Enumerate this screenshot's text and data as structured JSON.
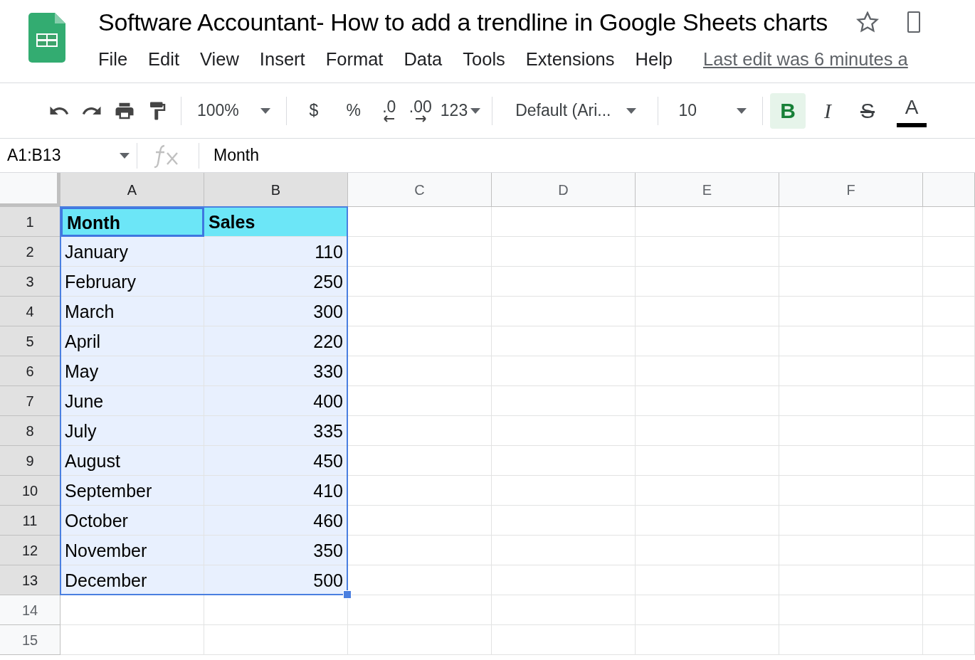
{
  "document": {
    "title": "Software Accountant- How to add a trendline in Google Sheets charts",
    "starred": false
  },
  "menu": [
    "File",
    "Edit",
    "View",
    "Insert",
    "Format",
    "Data",
    "Tools",
    "Extensions",
    "Help"
  ],
  "last_edit": "Last edit was 6 minutes a",
  "toolbar": {
    "zoom": "100%",
    "currency": "$",
    "percent": "%",
    "decrease_decimals": ".0",
    "increase_decimals": ".00",
    "number_format": "123",
    "font": "Default (Ari...",
    "font_size": "10",
    "styles": [
      {
        "kind": "bold",
        "label": "B",
        "on": true
      },
      {
        "kind": "italic",
        "label": "I",
        "on": false
      },
      {
        "kind": "strikethrough",
        "label": "S",
        "on": false
      }
    ],
    "text_color": {
      "label": "A",
      "color": "#000000"
    }
  },
  "formula_bar": {
    "name_box": "A1:B13",
    "formula": "Month"
  },
  "grid": {
    "columns": [
      {
        "label": "A",
        "selected": true
      },
      {
        "label": "B",
        "selected": true
      },
      {
        "label": "C",
        "selected": false
      },
      {
        "label": "D",
        "selected": false
      },
      {
        "label": "E",
        "selected": false
      },
      {
        "label": "F",
        "selected": false
      }
    ],
    "rows": [
      {
        "number": "1",
        "selected": true,
        "cells": [
          {
            "value": "Month",
            "kind": "header",
            "selected": true,
            "active": true
          },
          {
            "value": "Sales",
            "kind": "header",
            "selected": true,
            "active": false
          }
        ]
      },
      {
        "number": "2",
        "selected": true,
        "cells": [
          {
            "value": "January",
            "kind": "text",
            "selected": true,
            "active": false
          },
          {
            "value": "110",
            "kind": "number",
            "selected": true,
            "active": false
          }
        ]
      },
      {
        "number": "3",
        "selected": true,
        "cells": [
          {
            "value": "February",
            "kind": "text",
            "selected": true,
            "active": false
          },
          {
            "value": "250",
            "kind": "number",
            "selected": true,
            "active": false
          }
        ]
      },
      {
        "number": "4",
        "selected": true,
        "cells": [
          {
            "value": "March",
            "kind": "text",
            "selected": true,
            "active": false
          },
          {
            "value": "300",
            "kind": "number",
            "selected": true,
            "active": false
          }
        ]
      },
      {
        "number": "5",
        "selected": true,
        "cells": [
          {
            "value": "April",
            "kind": "text",
            "selected": true,
            "active": false
          },
          {
            "value": "220",
            "kind": "number",
            "selected": true,
            "active": false
          }
        ]
      },
      {
        "number": "6",
        "selected": true,
        "cells": [
          {
            "value": "May",
            "kind": "text",
            "selected": true,
            "active": false
          },
          {
            "value": "330",
            "kind": "number",
            "selected": true,
            "active": false
          }
        ]
      },
      {
        "number": "7",
        "selected": true,
        "cells": [
          {
            "value": "June",
            "kind": "text",
            "selected": true,
            "active": false
          },
          {
            "value": "400",
            "kind": "number",
            "selected": true,
            "active": false
          }
        ]
      },
      {
        "number": "8",
        "selected": true,
        "cells": [
          {
            "value": "July",
            "kind": "text",
            "selected": true,
            "active": false
          },
          {
            "value": "335",
            "kind": "number",
            "selected": true,
            "active": false
          }
        ]
      },
      {
        "number": "9",
        "selected": true,
        "cells": [
          {
            "value": "August",
            "kind": "text",
            "selected": true,
            "active": false
          },
          {
            "value": "450",
            "kind": "number",
            "selected": true,
            "active": false
          }
        ]
      },
      {
        "number": "10",
        "selected": true,
        "cells": [
          {
            "value": "September",
            "kind": "text",
            "selected": true,
            "active": false
          },
          {
            "value": "410",
            "kind": "number",
            "selected": true,
            "active": false
          }
        ]
      },
      {
        "number": "11",
        "selected": true,
        "cells": [
          {
            "value": "October",
            "kind": "text",
            "selected": true,
            "active": false
          },
          {
            "value": "460",
            "kind": "number",
            "selected": true,
            "active": false
          }
        ]
      },
      {
        "number": "12",
        "selected": true,
        "cells": [
          {
            "value": "November",
            "kind": "text",
            "selected": true,
            "active": false
          },
          {
            "value": "350",
            "kind": "number",
            "selected": true,
            "active": false
          }
        ]
      },
      {
        "number": "13",
        "selected": true,
        "cells": [
          {
            "value": "December",
            "kind": "text",
            "selected": true,
            "active": false
          },
          {
            "value": "500",
            "kind": "number",
            "selected": true,
            "active": false
          }
        ]
      },
      {
        "number": "14",
        "selected": false,
        "cells": []
      },
      {
        "number": "15",
        "selected": false,
        "cells": []
      }
    ]
  }
}
